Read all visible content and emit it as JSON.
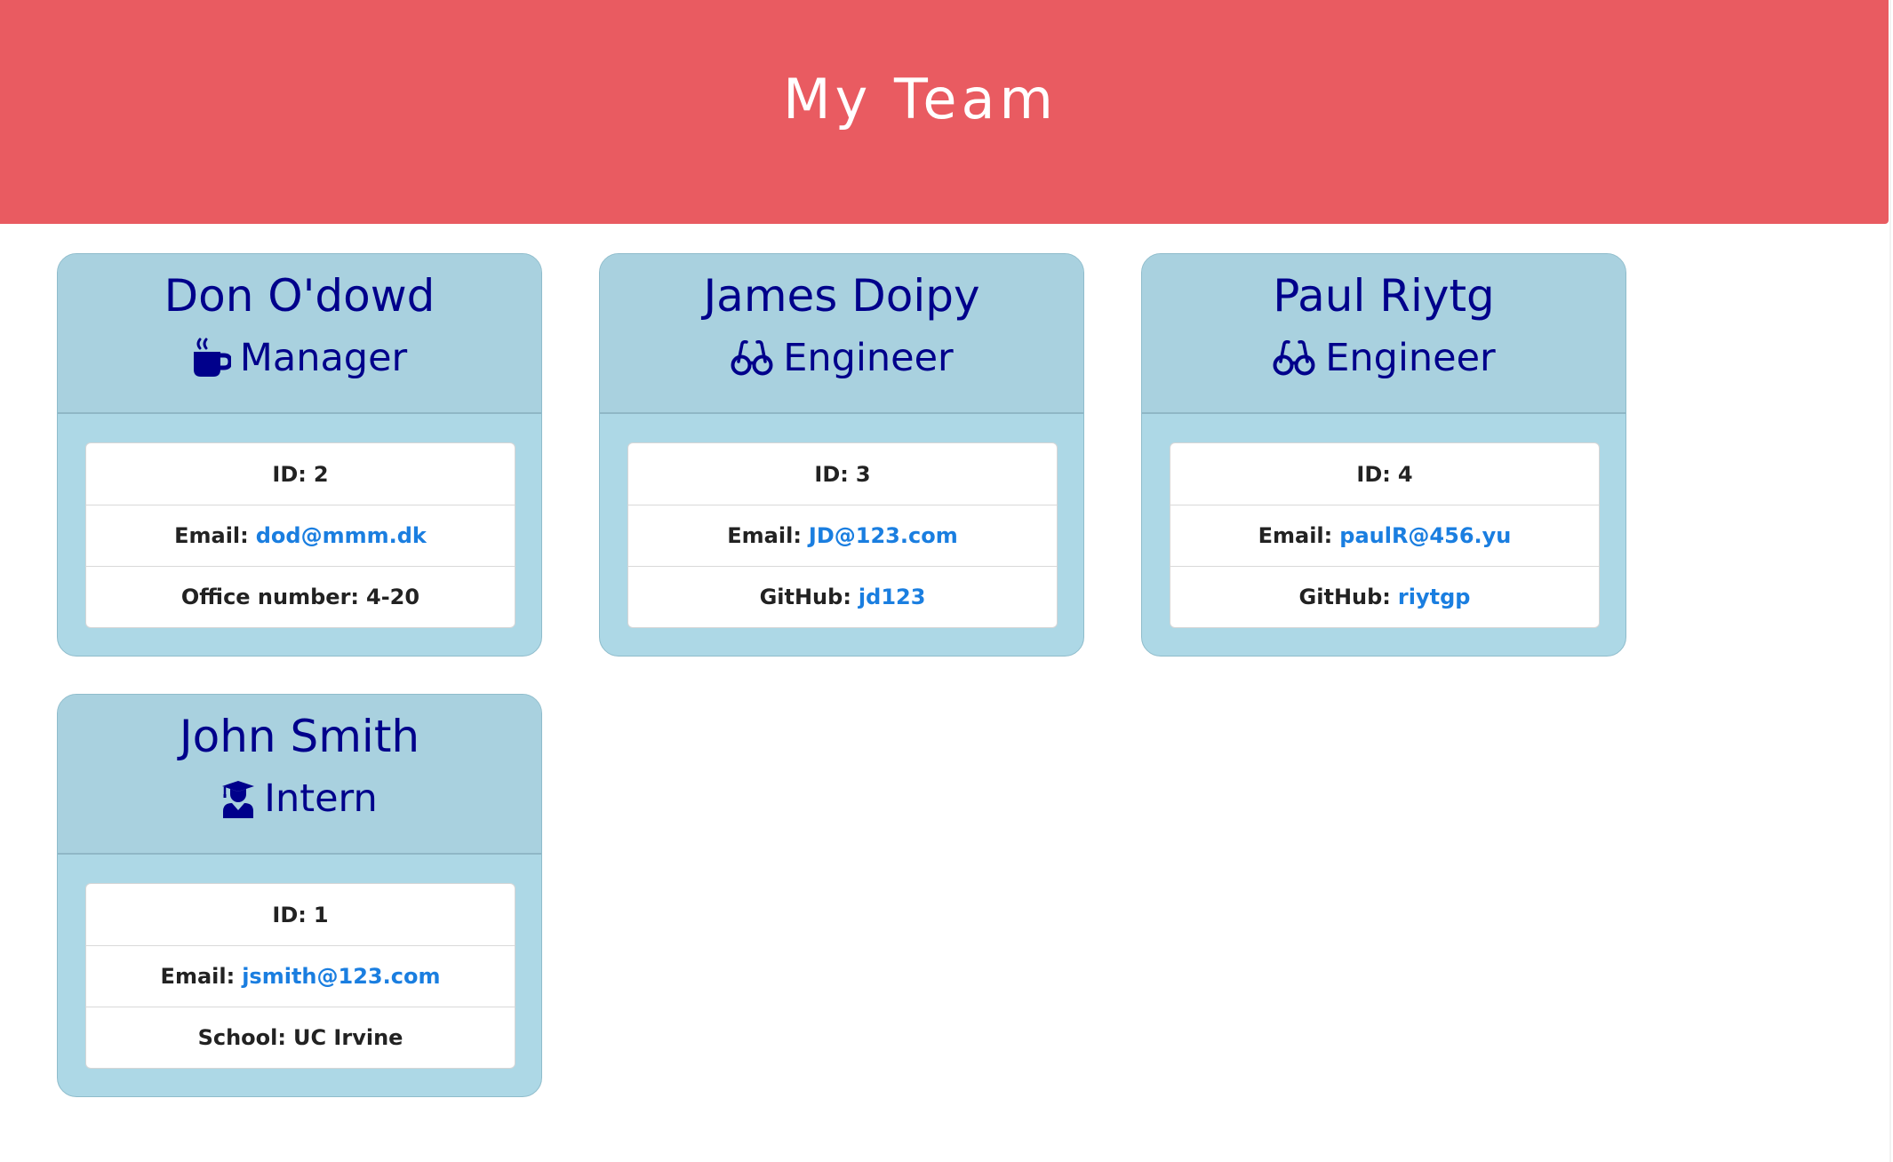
{
  "header": {
    "title": "My Team"
  },
  "colors": {
    "header_bg": "#e95b61",
    "card_bg": "#add8e6",
    "name_color": "#00008b",
    "link_color": "#1a7ee0"
  },
  "cards": [
    {
      "name": "Don O'dowd",
      "role": "Manager",
      "icon": "coffee-mug-icon",
      "id_label": "ID:",
      "id": "2",
      "email_label": "Email:",
      "email": "dod@mmm.dk",
      "extra_label": "Office number:",
      "extra_value": "4-20"
    },
    {
      "name": "James Doipy",
      "role": "Engineer",
      "icon": "glasses-icon",
      "id_label": "ID:",
      "id": "3",
      "email_label": "Email:",
      "email": "JD@123.com",
      "extra_label": "GitHub:",
      "extra_value": "jd123"
    },
    {
      "name": "Paul Riytg",
      "role": "Engineer",
      "icon": "glasses-icon",
      "id_label": "ID:",
      "id": "4",
      "email_label": "Email:",
      "email": "paulR@456.yu",
      "extra_label": "GitHub:",
      "extra_value": "riytgp"
    },
    {
      "name": "John Smith",
      "role": "Intern",
      "icon": "graduate-icon",
      "id_label": "ID:",
      "id": "1",
      "email_label": "Email:",
      "email": "jsmith@123.com",
      "extra_label": "School:",
      "extra_value": "UC Irvine"
    }
  ]
}
